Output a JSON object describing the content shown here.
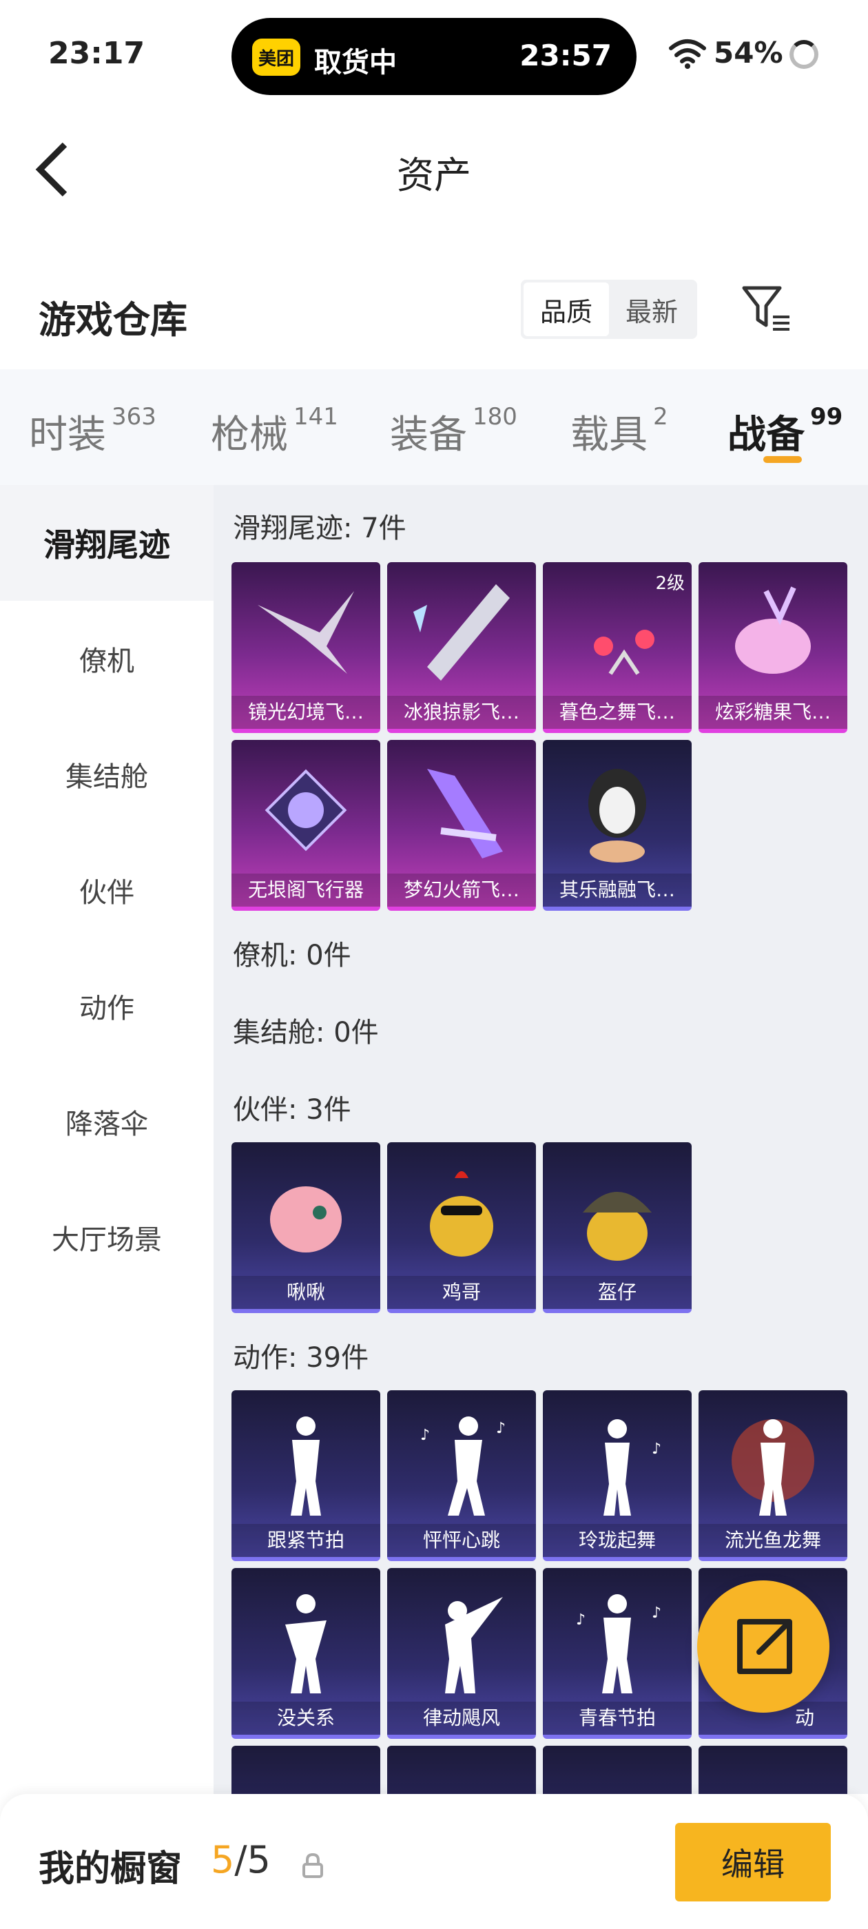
{
  "status_bar": {
    "time": "23:17",
    "pill_logo": "美团",
    "pill_text": "取货中",
    "pill_time": "23:57",
    "battery": "54%"
  },
  "header": {
    "title": "资产"
  },
  "warehouse": {
    "title": "游戏仓库",
    "sort_options": [
      "品质",
      "最新"
    ],
    "active_sort": "品质"
  },
  "tabs": [
    {
      "label": "时装",
      "count": "363"
    },
    {
      "label": "枪械",
      "count": "141"
    },
    {
      "label": "装备",
      "count": "180"
    },
    {
      "label": "载具",
      "count": "2"
    },
    {
      "label": "战备",
      "count": "99",
      "active": true
    }
  ],
  "sidebar": [
    {
      "label": "滑翔尾迹",
      "active": true
    },
    {
      "label": "僚机"
    },
    {
      "label": "集结舱"
    },
    {
      "label": "伙伴"
    },
    {
      "label": "动作"
    },
    {
      "label": "降落伞"
    },
    {
      "label": "大厅场景"
    }
  ],
  "sections": {
    "glide_trail": {
      "title": "滑翔尾迹: 7件",
      "items": [
        {
          "name": "镜光幻境飞…",
          "rarity": "purple"
        },
        {
          "name": "冰狼掠影飞…",
          "rarity": "purple"
        },
        {
          "name": "暮色之舞飞…",
          "rarity": "purple",
          "level": "2级"
        },
        {
          "name": "炫彩糖果飞…",
          "rarity": "purple"
        },
        {
          "name": "无垠阁飞行器",
          "rarity": "purple"
        },
        {
          "name": "梦幻火箭飞…",
          "rarity": "purple"
        },
        {
          "name": "其乐融融飞…",
          "rarity": "blue"
        }
      ]
    },
    "wingman": {
      "title": "僚机: 0件"
    },
    "pod": {
      "title": "集结舱: 0件"
    },
    "partner": {
      "title": "伙伴: 3件",
      "items": [
        {
          "name": "啾啾",
          "rarity": "blue"
        },
        {
          "name": "鸡哥",
          "rarity": "blue"
        },
        {
          "name": "盔仔",
          "rarity": "blue"
        }
      ]
    },
    "emote": {
      "title": "动作: 39件",
      "items": [
        {
          "name": "跟紧节拍",
          "rarity": "blue"
        },
        {
          "name": "怦怦心跳",
          "rarity": "blue"
        },
        {
          "name": "玲珑起舞",
          "rarity": "blue"
        },
        {
          "name": "流光鱼龙舞",
          "rarity": "blue"
        },
        {
          "name": "没关系",
          "rarity": "blue"
        },
        {
          "name": "律动飓风",
          "rarity": "blue"
        },
        {
          "name": "青春节拍",
          "rarity": "blue"
        },
        {
          "name": "动",
          "rarity": "blue"
        }
      ]
    }
  },
  "bottom_bar": {
    "title": "我的橱窗",
    "count_current": "5",
    "count_total": "/5",
    "edit_label": "编辑"
  },
  "colors": {
    "accent": "#f5a623",
    "purple_rarity": "#c13fbb",
    "blue_rarity": "#4b46a4"
  }
}
